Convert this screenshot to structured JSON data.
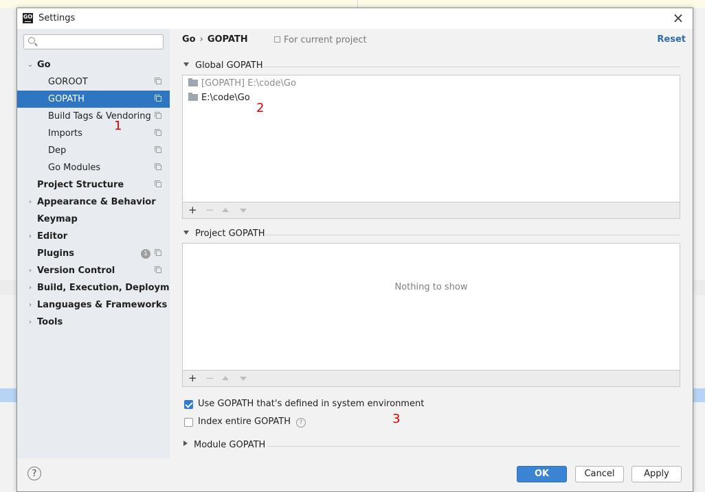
{
  "window": {
    "title": "Settings",
    "app_icon": "GO"
  },
  "sidebar": {
    "search_placeholder": "",
    "items": [
      {
        "label": "Go",
        "expanded": true,
        "bold": true
      },
      {
        "label": "GOROOT"
      },
      {
        "label": "GOPATH",
        "selected": true
      },
      {
        "label": "Build Tags & Vendoring"
      },
      {
        "label": "Imports"
      },
      {
        "label": "Dep"
      },
      {
        "label": "Go Modules"
      },
      {
        "label": "Project Structure",
        "bold": true
      },
      {
        "label": "Appearance & Behavior",
        "bold": true
      },
      {
        "label": "Keymap",
        "bold": true
      },
      {
        "label": "Editor",
        "bold": true
      },
      {
        "label": "Plugins",
        "bold": true,
        "badge": "1"
      },
      {
        "label": "Version Control",
        "bold": true
      },
      {
        "label": "Build, Execution, Deployment",
        "bold": true
      },
      {
        "label": "Languages & Frameworks",
        "bold": true
      },
      {
        "label": "Tools",
        "bold": true
      }
    ]
  },
  "breadcrumb": {
    "parent": "Go",
    "separator": "›",
    "current": "GOPATH"
  },
  "scope_note": "For current project",
  "reset_label": "Reset",
  "global_gopath": {
    "header": "Global GOPATH",
    "rows": [
      "[GOPATH] E:\\code\\Go",
      "E:\\code\\Go"
    ]
  },
  "project_gopath": {
    "header": "Project GOPATH",
    "empty_text": "Nothing to show"
  },
  "options": {
    "use_system_gopath": {
      "label": "Use GOPATH that's defined in system environment",
      "checked": true
    },
    "index_entire_gopath": {
      "label": "Index entire GOPATH",
      "checked": false
    }
  },
  "module_gopath": {
    "header": "Module GOPATH"
  },
  "annotations": [
    "1",
    "2",
    "3"
  ],
  "footer": {
    "help": "?",
    "ok": "OK",
    "cancel": "Cancel",
    "apply": "Apply"
  },
  "colors": {
    "selection": "#2e75c2",
    "accent": "#2c6bb6",
    "annotation": "#e00000"
  }
}
